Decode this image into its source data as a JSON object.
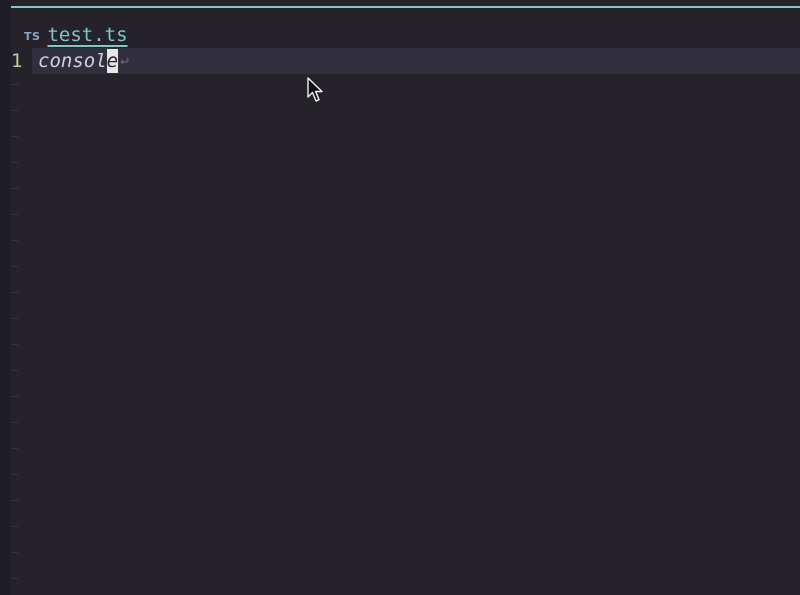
{
  "tab": {
    "icon": "typescript-file-icon",
    "icon_text": "TS",
    "filename": "test.ts"
  },
  "editor": {
    "current_line_number": "1",
    "code_before_cursor": "consol",
    "cursor_char": "e",
    "eol_icon": "return-arrow-icon",
    "eol_glyph": "↩"
  },
  "colors": {
    "background": "#252329",
    "accent": "#7fc6c9",
    "current_line_highlight": "#312f3d",
    "line_number": "#b7d1a0"
  }
}
